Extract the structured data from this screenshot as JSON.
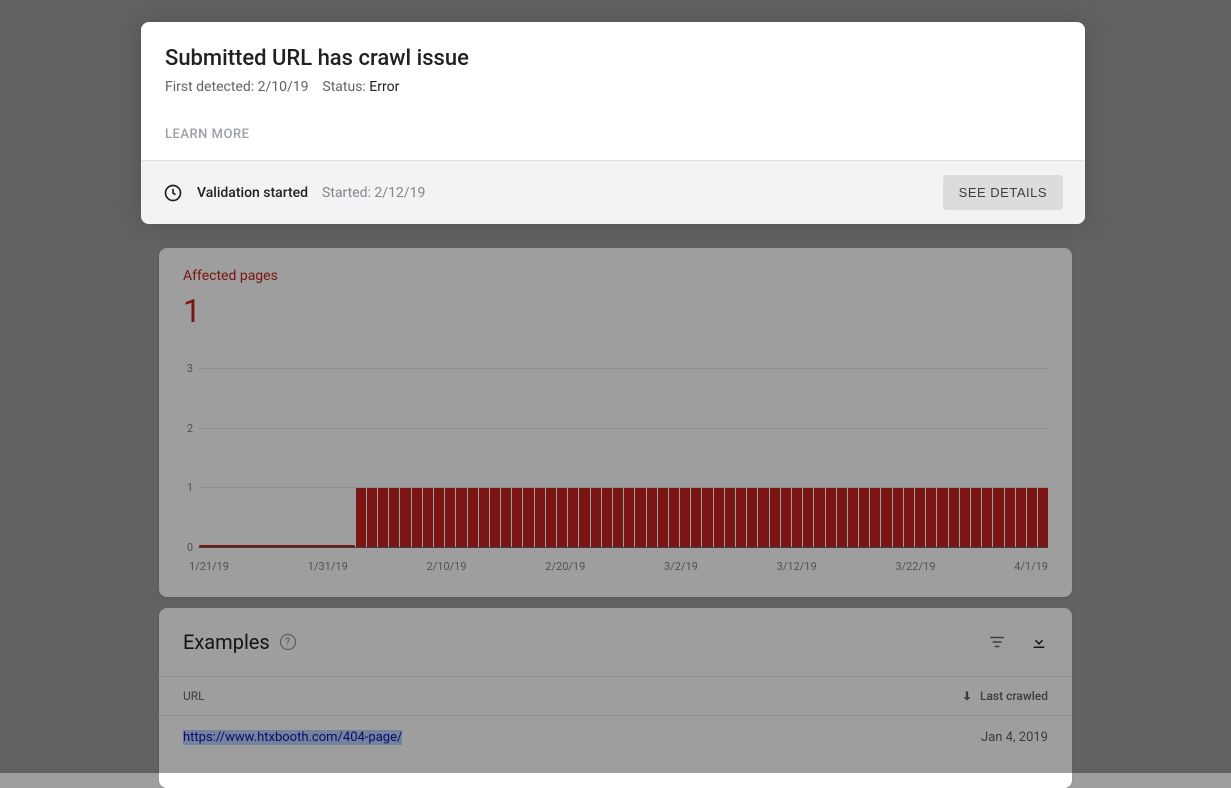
{
  "issue": {
    "title": "Submitted URL has crawl issue",
    "first_detected_label": "First detected:",
    "first_detected_date": "2/10/19",
    "status_label": "Status:",
    "status_value": "Error",
    "learn_more": "LEARN MORE"
  },
  "validation": {
    "label": "Validation started",
    "started_label": "Started:",
    "started_date": "2/12/19",
    "see_details": "SEE DETAILS"
  },
  "affected": {
    "label": "Affected pages",
    "count": "1"
  },
  "examples": {
    "title": "Examples",
    "columns": {
      "url": "URL",
      "last_crawled": "Last crawled"
    },
    "rows": [
      {
        "url": "https://www.htxbooth.com/404-page/",
        "date": "Jan 4, 2019"
      }
    ]
  },
  "chart_data": {
    "type": "bar",
    "title": "Affected pages",
    "ylabel": "",
    "xlabel": "",
    "ylim": [
      0,
      3
    ],
    "y_ticks": [
      0,
      1,
      2,
      3
    ],
    "x_ticks": [
      "1/21/19",
      "1/31/19",
      "2/10/19",
      "2/20/19",
      "3/2/19",
      "3/12/19",
      "3/22/19",
      "4/1/19"
    ],
    "categories_count": 76,
    "zero_run_start_index": 0,
    "zero_run_end_index": 13,
    "values": [
      0,
      0,
      0,
      0,
      0,
      0,
      0,
      0,
      0,
      0,
      0,
      0,
      0,
      0,
      1,
      1,
      1,
      1,
      1,
      1,
      1,
      1,
      1,
      1,
      1,
      1,
      1,
      1,
      1,
      1,
      1,
      1,
      1,
      1,
      1,
      1,
      1,
      1,
      1,
      1,
      1,
      1,
      1,
      1,
      1,
      1,
      1,
      1,
      1,
      1,
      1,
      1,
      1,
      1,
      1,
      1,
      1,
      1,
      1,
      1,
      1,
      1,
      1,
      1,
      1,
      1,
      1,
      1,
      1,
      1,
      1,
      1,
      1,
      1,
      1,
      1
    ]
  }
}
